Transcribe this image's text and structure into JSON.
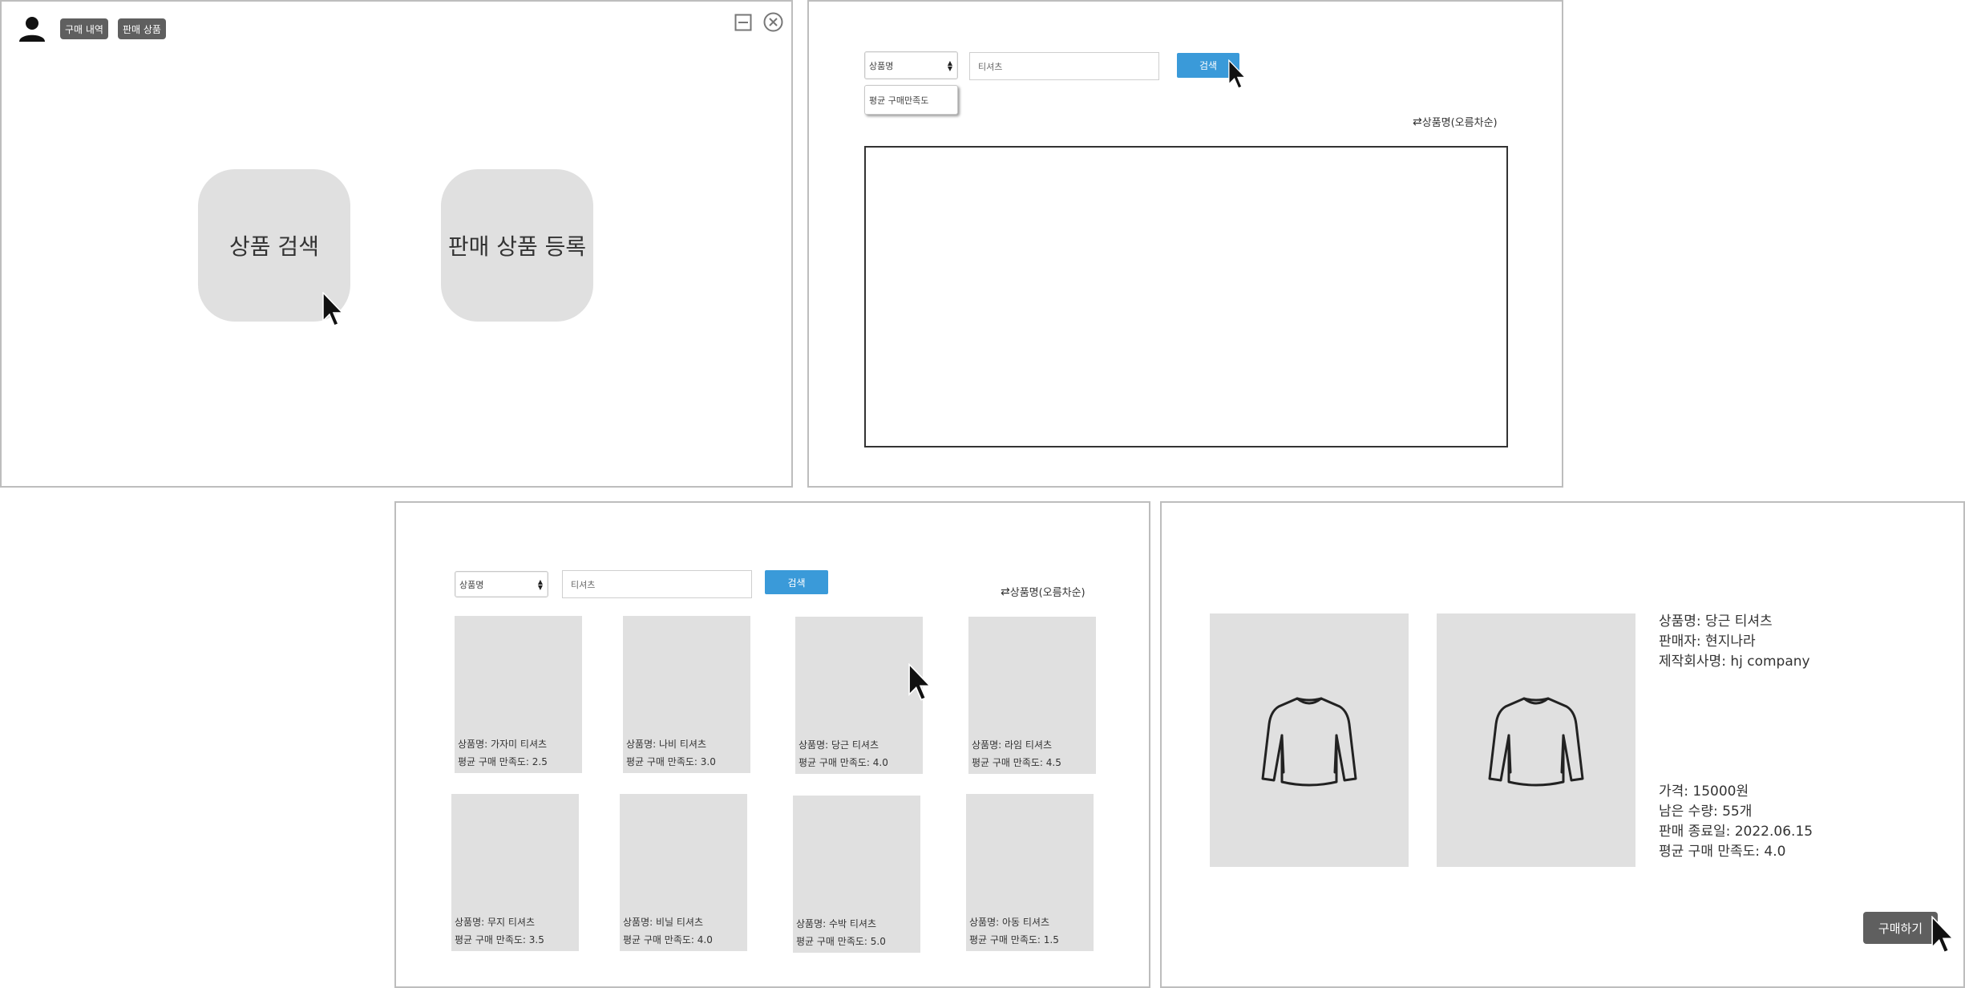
{
  "screen1": {
    "topbar": {
      "purchase_history": "구매 내역",
      "sales_items": "판매 상품"
    },
    "product_search_label": "상품 검색",
    "register_product_label": "판매 상품 등록"
  },
  "screen2": {
    "select_value": "상품명",
    "dropdown_option": "평균 구매만족도",
    "search_value": "티셔츠",
    "search_button": "검색",
    "sort_label": "상품명(오름차순)"
  },
  "screen3": {
    "select_value": "상품명",
    "search_value": "티셔츠",
    "search_button": "검색",
    "sort_label": "상품명(오름차순)",
    "products": [
      {
        "name": "상품명: 가자미 티셔츠",
        "rating": "평균 구매 만족도: 2.5"
      },
      {
        "name": "상품명: 나비 티셔츠",
        "rating": "평균 구매 만족도: 3.0"
      },
      {
        "name": "상품명: 당근 티셔츠",
        "rating": "평균 구매 만족도: 4.0"
      },
      {
        "name": "상품명: 라임 티셔츠",
        "rating": "평균 구매 만족도: 4.5"
      },
      {
        "name": "상품명: 무지 티셔츠",
        "rating": "평균 구매 만족도: 3.5"
      },
      {
        "name": "상품명: 비닐 티셔츠",
        "rating": "평균 구매 만족도: 4.0"
      },
      {
        "name": "상품명: 수박 티셔츠",
        "rating": "평균 구매 만족도: 5.0"
      },
      {
        "name": "상품명: 아동 티셔츠",
        "rating": "평균 구매 만족도: 1.5"
      }
    ]
  },
  "screen4": {
    "product_name": "상품명: 당근 티셔츠",
    "seller": "판매자: 현지나라",
    "manufacturer": "제작회사명: hj company",
    "price": "가격: 15000원",
    "remaining": "남은 수량: 55개",
    "sale_end": "판매 종료일: 2022.06.15",
    "avg_rating": "평균 구매 만족도: 4.0",
    "buy_button": "구매하기"
  },
  "icons": {
    "user": "user-icon",
    "minimize": "minimize-icon",
    "close": "close-icon",
    "select_arrows": "updown-arrows-icon",
    "sort": "swap-arrows-icon",
    "cursor": "mouse-pointer-icon",
    "shirt": "long-sleeve-shirt-icon"
  },
  "colors": {
    "primary_button": "#3a9ad9",
    "dark_button": "#5f5f5f",
    "placeholder_gray": "#e0e0e0",
    "panel_border": "#bdbdbd"
  }
}
